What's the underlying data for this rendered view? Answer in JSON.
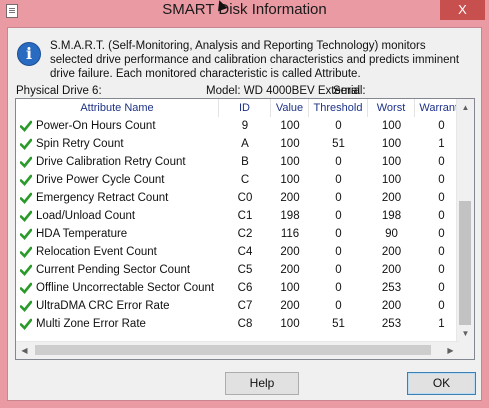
{
  "window": {
    "title": "SMART Disk Information",
    "close_glyph": "X"
  },
  "info": {
    "description": "S.M.A.R.T. (Self-Monitoring, Analysis and Reporting Technology) monitors selected drive performance and calibration characteristics and predicts imminent drive failure. Each monitored characteristic is called Attribute.",
    "icon": "info-icon",
    "icon_glyph": "i"
  },
  "drive": {
    "physical_drive": "Physical Drive 6:",
    "model": "Model: WD 4000BEV External",
    "serial_label": "Serial:"
  },
  "table": {
    "columns": [
      "Attribute Name",
      "ID",
      "Value",
      "Threshold",
      "Worst",
      "Warranty"
    ],
    "rows": [
      {
        "name": "Power-On Hours Count",
        "id": "9",
        "value": "100",
        "threshold": "0",
        "worst": "100",
        "warranty": "0"
      },
      {
        "name": "Spin Retry Count",
        "id": "A",
        "value": "100",
        "threshold": "51",
        "worst": "100",
        "warranty": "1"
      },
      {
        "name": "Drive Calibration Retry Count",
        "id": "B",
        "value": "100",
        "threshold": "0",
        "worst": "100",
        "warranty": "0"
      },
      {
        "name": "Drive Power Cycle Count",
        "id": "C",
        "value": "100",
        "threshold": "0",
        "worst": "100",
        "warranty": "0"
      },
      {
        "name": "Emergency Retract Count",
        "id": "C0",
        "value": "200",
        "threshold": "0",
        "worst": "200",
        "warranty": "0"
      },
      {
        "name": "Load/Unload Count",
        "id": "C1",
        "value": "198",
        "threshold": "0",
        "worst": "198",
        "warranty": "0"
      },
      {
        "name": "HDA Temperature",
        "id": "C2",
        "value": "116",
        "threshold": "0",
        "worst": "90",
        "warranty": "0"
      },
      {
        "name": "Relocation Event Count",
        "id": "C4",
        "value": "200",
        "threshold": "0",
        "worst": "200",
        "warranty": "0"
      },
      {
        "name": "Current Pending Sector Count",
        "id": "C5",
        "value": "200",
        "threshold": "0",
        "worst": "200",
        "warranty": "0"
      },
      {
        "name": "Offline Uncorrectable Sector Count",
        "id": "C6",
        "value": "100",
        "threshold": "0",
        "worst": "253",
        "warranty": "0"
      },
      {
        "name": "UltraDMA CRC Error Rate",
        "id": "C7",
        "value": "200",
        "threshold": "0",
        "worst": "200",
        "warranty": "0"
      },
      {
        "name": "Multi Zone Error Rate",
        "id": "C8",
        "value": "100",
        "threshold": "51",
        "worst": "253",
        "warranty": "1"
      }
    ],
    "status_icon": "check-icon",
    "status_color": "#2a9a2a",
    "header_color": "#1e3287"
  },
  "buttons": {
    "help": "Help",
    "ok": "OK"
  },
  "colors": {
    "title_bar": "#e99aa3",
    "close_button": "#c7504f"
  }
}
